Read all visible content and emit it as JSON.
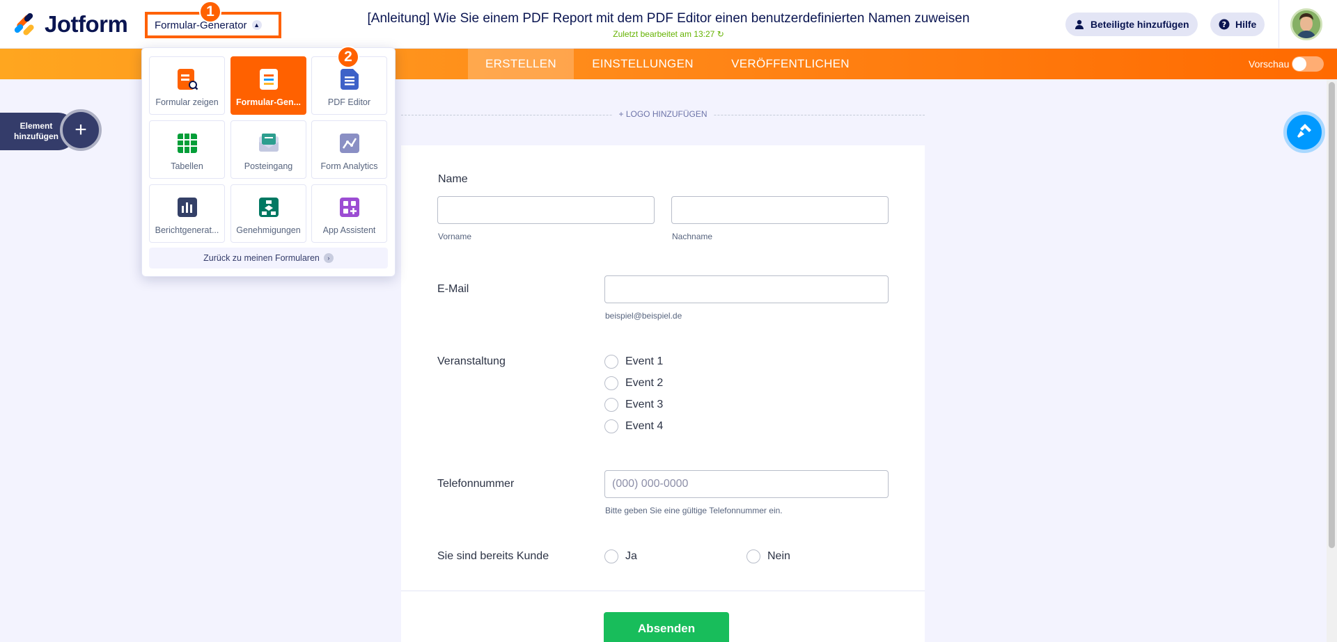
{
  "header": {
    "logo_text": "Jotform",
    "builder_dropdown_label": "Formular-Generator",
    "step_1": "1",
    "step_2": "2",
    "form_title": "[Anleitung] Wie Sie einem PDF Report mit dem PDF Editor einen benutzerdefinierten Namen zuweisen",
    "last_edited": "Zuletzt bearbeitet am 13:27",
    "add_participants": "Beteiligte hinzufügen",
    "help": "Hilfe"
  },
  "nav": {
    "tabs": [
      {
        "label": "ERSTELLEN",
        "active": true
      },
      {
        "label": "EINSTELLUNGEN",
        "active": false
      },
      {
        "label": "VERÖFFENTLICHEN",
        "active": false
      }
    ],
    "preview_label": "Vorschau",
    "preview_on": false
  },
  "dropdown": {
    "tiles": [
      {
        "label": "Formular zeigen",
        "icon": "form-view-icon",
        "active": false
      },
      {
        "label": "Formular-Gen...",
        "icon": "form-builder-icon",
        "active": true
      },
      {
        "label": "PDF Editor",
        "icon": "pdf-editor-icon",
        "active": false
      },
      {
        "label": "Tabellen",
        "icon": "tables-icon",
        "active": false
      },
      {
        "label": "Posteingang",
        "icon": "inbox-icon",
        "active": false
      },
      {
        "label": "Form Analytics",
        "icon": "analytics-icon",
        "active": false
      },
      {
        "label": "Berichtgenerat...",
        "icon": "report-builder-icon",
        "active": false
      },
      {
        "label": "Genehmigungen",
        "icon": "approvals-icon",
        "active": false
      },
      {
        "label": "App Assistent",
        "icon": "app-assistant-icon",
        "active": false
      }
    ],
    "back_link": "Zurück zu meinen Formularen"
  },
  "sidebar": {
    "add_element_label": "Element hinzufügen"
  },
  "form": {
    "logo_add": "+ LOGO HINZUFÜGEN",
    "name_label": "Name",
    "first_name_sub": "Vorname",
    "last_name_sub": "Nachname",
    "email_label": "E-Mail",
    "email_sub": "beispiel@beispiel.de",
    "event_label": "Veranstaltung",
    "events": [
      "Event 1",
      "Event 2",
      "Event 3",
      "Event 4"
    ],
    "phone_label": "Telefonnummer",
    "phone_placeholder": "(000) 000-0000",
    "phone_sub": "Bitte geben Sie eine gültige Telefonnummer ein.",
    "customer_label": "Sie sind bereits Kunde",
    "customer_options": [
      "Ja",
      "Nein"
    ],
    "submit_label": "Absenden"
  },
  "colors": {
    "accent": "#ff6100",
    "submit": "#18bd5b",
    "navy": "#0a1551",
    "last_edited": "#64b200"
  }
}
